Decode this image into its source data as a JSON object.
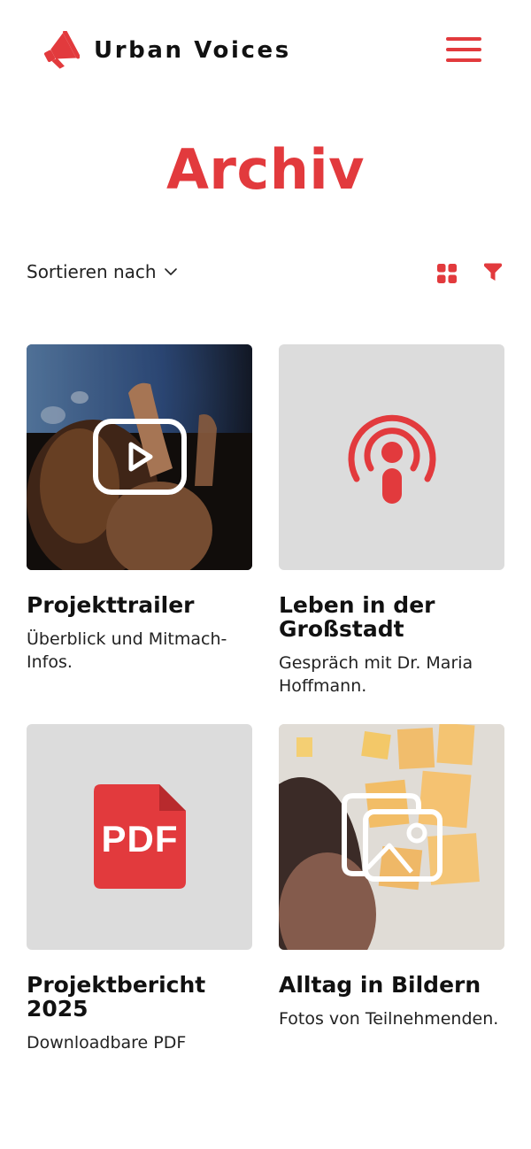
{
  "brand": {
    "name": "Urban Voices",
    "accent_color": "#e23a3d",
    "logo_icon": "megaphone-icon"
  },
  "header": {
    "menu_icon": "hamburger-menu-icon"
  },
  "page": {
    "title": "Archiv"
  },
  "toolbar": {
    "sort_label": "Sortieren nach",
    "sort_icon": "chevron-down-icon",
    "view_icon": "grid-view-icon",
    "filter_icon": "filter-icon"
  },
  "items": [
    {
      "title": "Projekttrailer",
      "description": "Überblick und Mitmach-Infos.",
      "media_type": "video",
      "icon": "play-icon"
    },
    {
      "title": "Leben in der Großstadt",
      "description": "Gespräch mit Dr. Maria Hoffmann.",
      "media_type": "podcast",
      "icon": "podcast-icon"
    },
    {
      "title": "Projektbericht 2025",
      "description": "Downloadbare PDF",
      "media_type": "pdf",
      "icon": "pdf-icon",
      "icon_text": "PDF"
    },
    {
      "title": "Alltag in Bildern",
      "description": "Fotos von Teilnehmenden.",
      "media_type": "gallery",
      "icon": "gallery-icon"
    }
  ]
}
